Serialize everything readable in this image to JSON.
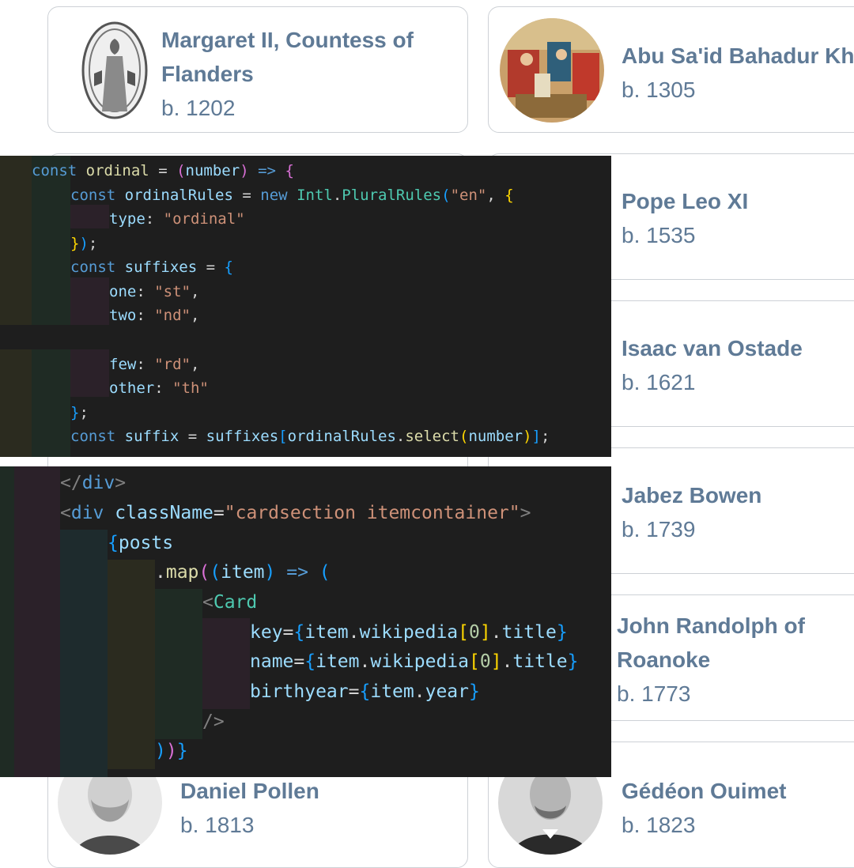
{
  "cards": [
    {
      "name": "Margaret II, Countess of Flanders",
      "year": "b. 1202",
      "icon": "seal-portrait"
    },
    {
      "name": "Abu Sa'id Bahadur Khan",
      "year": "b. 1305",
      "icon": "miniature-painting-portrait"
    },
    {
      "name": "Pope Leo XI",
      "year": "b. 1535"
    },
    {
      "name": "Isaac van Ostade",
      "year": "b. 1621"
    },
    {
      "name": "Jabez Bowen",
      "year": "b. 1739"
    },
    {
      "name": "John Randolph of Roanoke",
      "year": "b. 1773"
    },
    {
      "name": "Daniel Pollen",
      "year": "b. 1813",
      "icon": "bearded-man-photo"
    },
    {
      "name": "Gédéon Ouimet",
      "year": "b. 1823",
      "icon": "man-photo"
    }
  ],
  "code_snippets": {
    "ordinal": [
      "const ordinal = (number) => {",
      "    const ordinalRules = new Intl.PluralRules(\"en\", {",
      "        type: \"ordinal\"",
      "    });",
      "    const suffixes = {",
      "        one: \"st\",",
      "        two: \"nd\",",
      "",
      "        few: \"rd\",",
      "        other: \"th\"",
      "    };",
      "    const suffix = suffixes[ordinalRules.select(number)];"
    ],
    "jsx": [
      "    </div>",
      "    <div className=\"cardsection itemcontainer\">",
      "        {posts",
      "            .map((item) => (",
      "                <Card",
      "                    key={item.wikipedia[0].title}",
      "                    name={item.wikipedia[0].title}",
      "                    birthyear={item.year}",
      "                />",
      "            ))}"
    ]
  }
}
